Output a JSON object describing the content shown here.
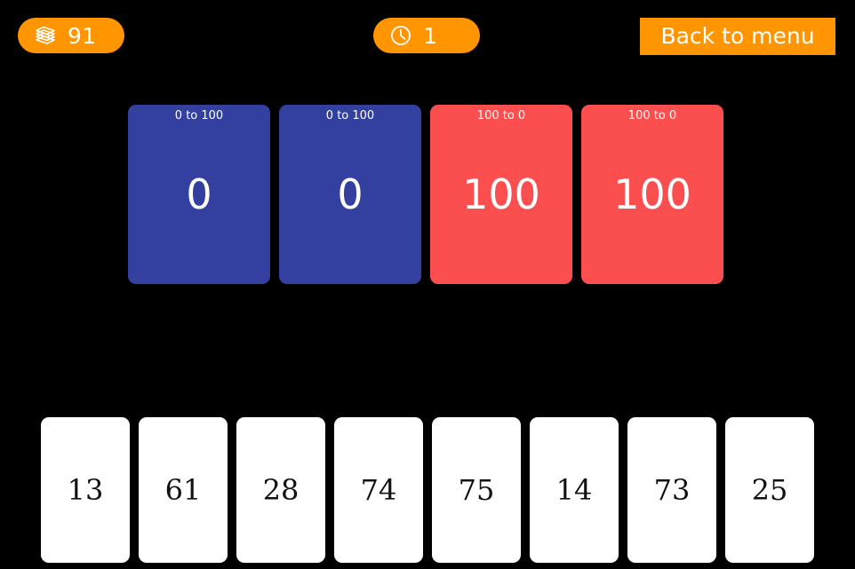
{
  "topbar": {
    "deck_badge": {
      "icon": "card-stack-icon",
      "value": "91"
    },
    "turn_badge": {
      "icon": "clock-icon",
      "value": "1"
    },
    "menu_button_label": "Back to menu"
  },
  "piles": [
    {
      "label": "0 to 100",
      "value": "0",
      "direction": "ascending",
      "color": "#3340A0"
    },
    {
      "label": "0 to 100",
      "value": "0",
      "direction": "ascending",
      "color": "#3340A0"
    },
    {
      "label": "100 to 0",
      "value": "100",
      "direction": "descending",
      "color": "#FB4E4E"
    },
    {
      "label": "100 to 0",
      "value": "100",
      "direction": "descending",
      "color": "#FB4E4E"
    }
  ],
  "hand": [
    {
      "value": "13"
    },
    {
      "value": "61"
    },
    {
      "value": "28"
    },
    {
      "value": "74"
    },
    {
      "value": "75"
    },
    {
      "value": "14"
    },
    {
      "value": "73"
    },
    {
      "value": "25"
    }
  ],
  "colors": {
    "background": "#000000",
    "accent": "#FF9500",
    "ascending_pile": "#3340A0",
    "descending_pile": "#FB4E4E",
    "hand_card": "#FFFFFF",
    "text_light": "#FFFFFF",
    "text_dark": "#111111"
  }
}
